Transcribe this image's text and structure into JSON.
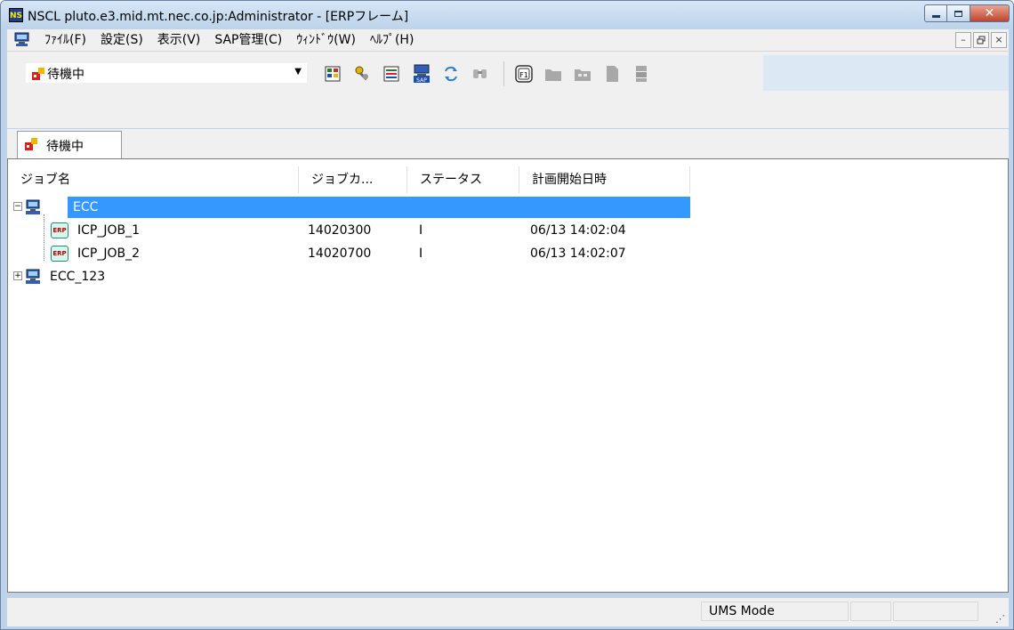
{
  "window": {
    "app_icon_text": "NS",
    "title": "NSCL pluto.e3.mid.mt.nec.co.jp:Administrator - [ERPフレーム]",
    "caption": {
      "close_glyph": "✕"
    }
  },
  "menu": {
    "items": [
      "ﾌｧｲﾙ(F)",
      "設定(S)",
      "表示(V)",
      "SAP管理(C)",
      "ｳｨﾝﾄﾞｳ(W)",
      "ﾍﾙﾌﾟ(H)"
    ],
    "mdi": {
      "minimize": "–",
      "restore": "ð",
      "close": "×"
    }
  },
  "toolbar": {
    "combo_value": "待機中",
    "combo_arrow": "▼",
    "icons": [
      "job-monitor-icon",
      "key-icon",
      "job-list-icon",
      "sap-icon",
      "refresh-icon",
      "binoculars-icon",
      "f1-help-icon",
      "folder-icon",
      "folder-grid-icon",
      "document-icon",
      "server-icon"
    ]
  },
  "tab": {
    "label": "待機中"
  },
  "list": {
    "columns": [
      "ジョブ名",
      "ジョブカ...",
      "ステータス",
      "計画開始日時"
    ],
    "rows": [
      {
        "name": "ECC",
        "count": "",
        "status": "",
        "start": "",
        "expander": "−",
        "type": "server",
        "selected": true
      },
      {
        "name": "ICP_JOB_1",
        "count": "14020300",
        "status": "I",
        "start": "06/13 14:02:04",
        "type": "job"
      },
      {
        "name": "ICP_JOB_2",
        "count": "14020700",
        "status": "I",
        "start": "06/13 14:02:07",
        "type": "job"
      },
      {
        "name": "ECC_123",
        "count": "",
        "status": "",
        "start": "",
        "expander": "+",
        "type": "server"
      }
    ]
  },
  "status": {
    "mode": "UMS Mode"
  },
  "colors": {
    "selection": "#3399ff",
    "title_bar": "#bcd3ea",
    "close_button": "#c0442b"
  }
}
